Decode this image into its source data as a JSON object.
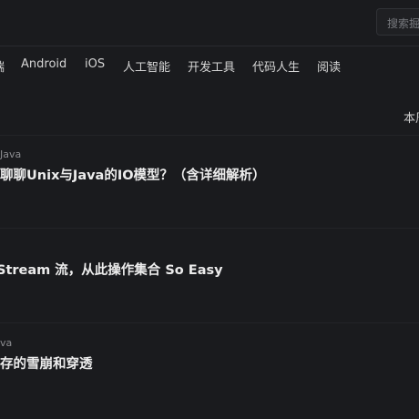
{
  "header": {
    "search_placeholder": "搜索掘"
  },
  "nav": {
    "items": [
      {
        "label": "端"
      },
      {
        "label": "Android"
      },
      {
        "label": "iOS"
      },
      {
        "label": "人工智能"
      },
      {
        "label": "开发工具"
      },
      {
        "label": "代码人生"
      },
      {
        "label": "阅读"
      }
    ]
  },
  "sidebar": {
    "right_label": "本周"
  },
  "articles": [
    {
      "meta": "Java",
      "title": "聊聊Unix与Java的IO模型？（含详细解析）"
    },
    {
      "meta": "",
      "title": "Stream 流，从此操作集合 So Easy"
    },
    {
      "meta": "va",
      "title": "存的雪崩和穿透"
    }
  ]
}
